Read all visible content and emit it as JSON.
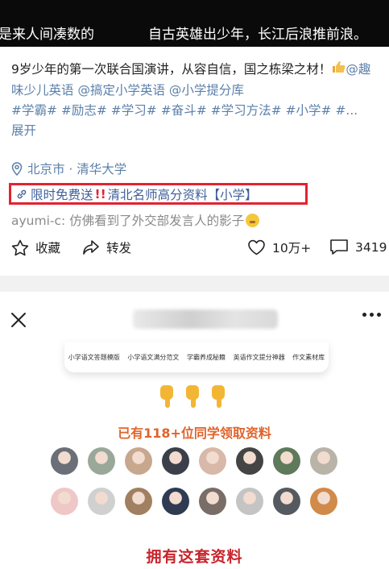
{
  "video": {
    "subtitle_left": "是来人间凑数的",
    "subtitle_right": "自古英雄出少年，长江后浪推前浪。"
  },
  "post": {
    "desc_text": "9岁少年的第一次联合国演讲，从容自信，国之栋梁之材！",
    "thumb_icon": "thumbs-up-icon",
    "mention_1": "@趣味少儿英语",
    "mention_2": "@搞定小学英语",
    "mention_3": "@小学提分库",
    "tags_line": "#学霸# #励志# #学习# #奋斗# #学习方法# #小学# #...",
    "expand": "展开"
  },
  "location": {
    "icon": "location-pin-icon",
    "text": "北京市 · 清华大学"
  },
  "promo": {
    "icon": "link-icon",
    "text_before": "限时免费送",
    "bang": "!!",
    "text_after": "清北名师高分资料【小学】",
    "highlight_color": "#e52230"
  },
  "comment": {
    "text": "ayumi-c: 仿佛看到了外交部发言人的影子",
    "emoji": "face-emoji-icon"
  },
  "actions": {
    "favorite": {
      "icon": "star-outline-icon",
      "label": "收藏"
    },
    "share": {
      "icon": "share-arrow-icon",
      "label": "转发"
    },
    "like": {
      "icon": "heart-outline-icon",
      "label": "10万+"
    },
    "comments": {
      "icon": "comment-bubble-icon",
      "label": "3419"
    }
  },
  "sheet": {
    "close_icon": "close-icon",
    "more_icon": "more-dots-icon",
    "card_items": [
      "小学语文答题模版",
      "小学语文满分范文",
      "学霸养成秘籍",
      "英语作文提分神器",
      "作文素材库"
    ],
    "pointing_icon": "pointing-down-hand-icon",
    "claim_text": "已有118+位同学领取资料",
    "avatar_colors": [
      "#6b6f78",
      "#9aa89a",
      "#c7a78e",
      "#3b3f4a",
      "#d8b8a8",
      "#444444",
      "#5e7a5a",
      "#b9b3a8",
      "#efc7c7",
      "#d0d0d0",
      "#a08060",
      "#2f3b52",
      "#7a6d68",
      "#c4c4c4",
      "#555a60",
      "#d08a4a"
    ],
    "cta": "拥有这套资料",
    "accent_color": "#e0632a"
  }
}
